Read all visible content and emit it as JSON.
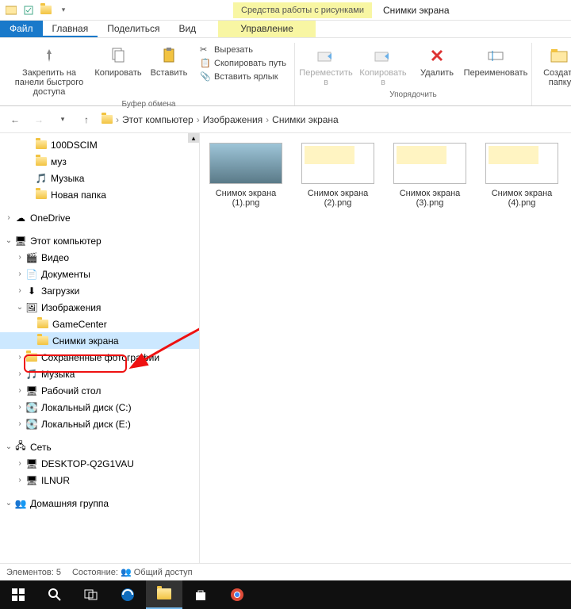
{
  "titlebar": {
    "contextual_tools": "Средства работы с рисунками",
    "window_title": "Снимки экрана"
  },
  "tabs": {
    "file": "Файл",
    "home": "Главная",
    "share": "Поделиться",
    "view": "Вид",
    "manage": "Управление"
  },
  "ribbon": {
    "pin": "Закрепить на панели быстрого доступа",
    "copy": "Копировать",
    "paste": "Вставить",
    "cut": "Вырезать",
    "copy_path": "Скопировать путь",
    "paste_shortcut": "Вставить ярлык",
    "clipboard_group": "Буфер обмена",
    "move_to": "Переместить в",
    "copy_to": "Копировать в",
    "delete": "Удалить",
    "rename": "Переименовать",
    "organize_group": "Упорядочить",
    "new_folder": "Создать папку"
  },
  "breadcrumbs": {
    "this_pc": "Этот компьютер",
    "pictures": "Изображения",
    "screenshots": "Снимки экрана"
  },
  "tree": {
    "dscim": "100DSCIM",
    "muz": "муз",
    "music": "Музыка",
    "new_folder": "Новая папка",
    "onedrive": "OneDrive",
    "this_pc": "Этот компьютер",
    "videos": "Видео",
    "documents": "Документы",
    "downloads": "Загрузки",
    "pictures": "Изображения",
    "gamecenter": "GameCenter",
    "screenshots": "Снимки экрана",
    "saved_photos": "Сохраненные фотографии",
    "music2": "Музыка",
    "desktop": "Рабочий стол",
    "disk_c": "Локальный диск (C:)",
    "disk_e": "Локальный диск (E:)",
    "network": "Сеть",
    "desktop_pc": "DESKTOP-Q2G1VAU",
    "ilnur": "ILNUR",
    "homegroup": "Домашняя группа"
  },
  "files": [
    {
      "name": "Снимок экрана (1).png"
    },
    {
      "name": "Снимок экрана (2).png"
    },
    {
      "name": "Снимок экрана (3).png"
    },
    {
      "name": "Снимок экрана (4).png"
    }
  ],
  "status": {
    "count_label": "Элементов:",
    "count": "5",
    "state_label": "Состояние:",
    "state": "Общий доступ"
  }
}
